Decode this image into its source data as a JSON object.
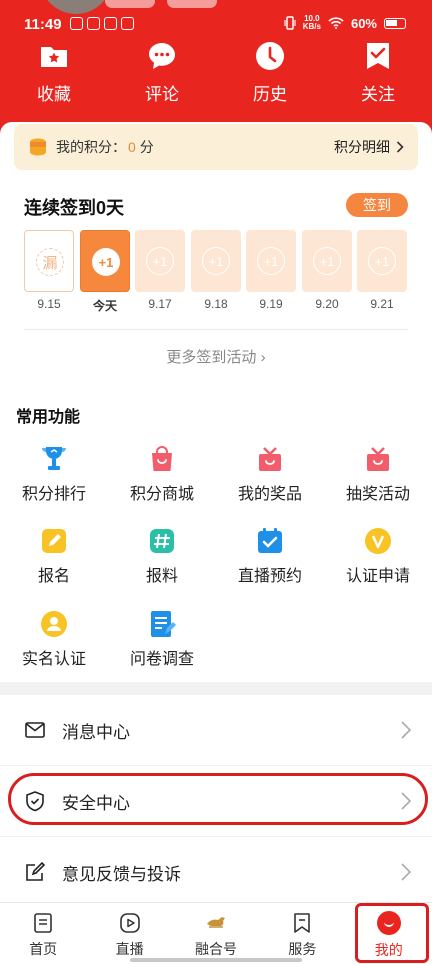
{
  "status_bar": {
    "time": "11:49",
    "net_speed_value": "10.0",
    "net_speed_unit": "KB/s",
    "battery": "60%"
  },
  "quick_actions": [
    {
      "label": "收藏",
      "icon": "folder-star-icon"
    },
    {
      "label": "评论",
      "icon": "chat-bubble-icon"
    },
    {
      "label": "历史",
      "icon": "clock-icon"
    },
    {
      "label": "关注",
      "icon": "bookmark-check-icon"
    }
  ],
  "points": {
    "label": "我的积分：",
    "value": "0",
    "unit": "分",
    "detail_link": "积分明细"
  },
  "checkin": {
    "title": "连续签到0天",
    "button": "签到",
    "days": [
      {
        "bubble": "漏",
        "date": "9.15",
        "state": "missed"
      },
      {
        "bubble": "+1",
        "date": "今天",
        "state": "today"
      },
      {
        "bubble": "+1",
        "date": "9.17",
        "state": "future"
      },
      {
        "bubble": "+1",
        "date": "9.18",
        "state": "future"
      },
      {
        "bubble": "+1",
        "date": "9.19",
        "state": "future"
      },
      {
        "bubble": "+1",
        "date": "9.20",
        "state": "future"
      },
      {
        "bubble": "+1",
        "date": "9.21",
        "state": "future"
      }
    ],
    "more_link": "更多签到活动 ›"
  },
  "functions": {
    "title": "常用功能",
    "items": [
      {
        "label": "积分排行",
        "icon": "trophy-icon"
      },
      {
        "label": "积分商城",
        "icon": "shopping-bag-icon"
      },
      {
        "label": "我的奖品",
        "icon": "gift-icon"
      },
      {
        "label": "抽奖活动",
        "icon": "lottery-gift-icon"
      },
      {
        "label": "报名",
        "icon": "edit-pencil-icon"
      },
      {
        "label": "报料",
        "icon": "hashtag-icon"
      },
      {
        "label": "直播预约",
        "icon": "calendar-check-icon"
      },
      {
        "label": "认证申请",
        "icon": "verified-v-icon"
      },
      {
        "label": "实名认证",
        "icon": "user-id-icon"
      },
      {
        "label": "问卷调查",
        "icon": "survey-icon"
      }
    ]
  },
  "menu": [
    {
      "label": "消息中心",
      "icon": "mail-icon"
    },
    {
      "label": "安全中心",
      "icon": "shield-check-icon"
    },
    {
      "label": "意见反馈与投诉",
      "icon": "feedback-edit-icon"
    }
  ],
  "bottom_nav": [
    {
      "label": "首页",
      "icon": "news-doc-icon"
    },
    {
      "label": "直播",
      "icon": "play-circle-icon"
    },
    {
      "label": "融合号",
      "icon": "horse-logo-icon"
    },
    {
      "label": "服务",
      "icon": "service-bookmark-icon"
    },
    {
      "label": "我的",
      "icon": "smile-face-icon"
    }
  ],
  "colors": {
    "header_red": "#e8261f",
    "accent_orange": "#f5883d",
    "highlight_red": "#d81e1e"
  }
}
